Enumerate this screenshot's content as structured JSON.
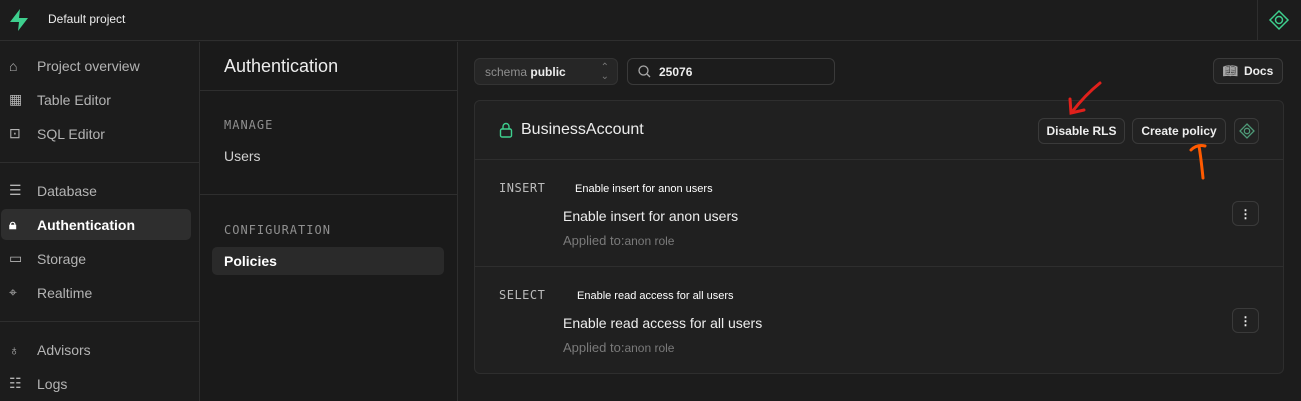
{
  "topbar": {
    "project_name": "Default project"
  },
  "sidebar": {
    "items": [
      {
        "label": "Project overview",
        "icon": "home-icon"
      },
      {
        "label": "Table Editor",
        "icon": "table-icon"
      },
      {
        "label": "SQL Editor",
        "icon": "terminal-icon"
      },
      {
        "label": "Database",
        "icon": "database-icon"
      },
      {
        "label": "Authentication",
        "icon": "lock-file-icon",
        "active": true
      },
      {
        "label": "Storage",
        "icon": "archive-icon"
      },
      {
        "label": "Realtime",
        "icon": "cursor-icon"
      },
      {
        "label": "Advisors",
        "icon": "lightbulb-icon"
      },
      {
        "label": "Logs",
        "icon": "list-icon"
      }
    ]
  },
  "secondary": {
    "title": "Authentication",
    "manage_label": "MANAGE",
    "users": "Users",
    "configuration_label": "CONFIGURATION",
    "policies": "Policies"
  },
  "toolbar": {
    "schema_label": "schema",
    "schema_value": "public",
    "search_value": "25076",
    "docs": "Docs"
  },
  "card": {
    "table_name": "BusinessAccount",
    "disable_rls": "Disable RLS",
    "create_policy": "Create policy",
    "policies": [
      {
        "command": "INSERT",
        "tooltip": "Enable insert for anon users",
        "name": "Enable insert for anon users",
        "applied_label": "Applied to:",
        "role": "anon role"
      },
      {
        "command": "SELECT",
        "tooltip": "Enable read access for all users",
        "name": "Enable read access for all users",
        "applied_label": "Applied to:",
        "role": "anon role"
      }
    ]
  },
  "colors": {
    "brand": "#3ecf8e",
    "annotation_red": "#e0201b",
    "annotation_orange": "#ff5a00"
  }
}
